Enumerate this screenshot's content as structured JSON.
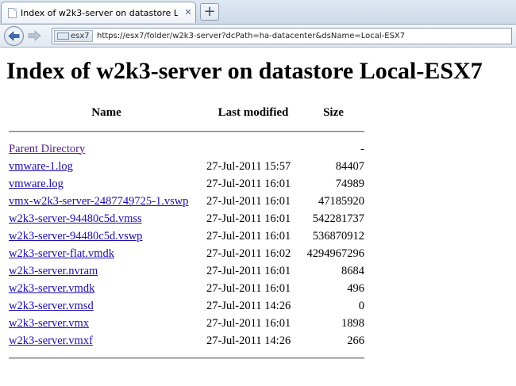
{
  "browser": {
    "tab_title": "Index of w2k3-server on datastore Local-ES...",
    "new_tab_symbol": "+",
    "site_chip": "esx7",
    "url": "https://esx7/folder/w2k3-server?dcPath=ha-datacenter&dsName=Local-ESX7"
  },
  "page": {
    "heading": "Index of w2k3-server on datastore Local-ESX7",
    "columns": {
      "name": "Name",
      "modified": "Last modified",
      "size": "Size"
    },
    "parent": {
      "name": "Parent Directory",
      "modified": "",
      "size": "-"
    },
    "files": [
      {
        "name": "vmware-1.log",
        "modified": "27-Jul-2011 15:57",
        "size": "84407"
      },
      {
        "name": "vmware.log",
        "modified": "27-Jul-2011 16:01",
        "size": "74989"
      },
      {
        "name": "vmx-w2k3-server-2487749725-1.vswp",
        "modified": "27-Jul-2011 16:01",
        "size": "47185920"
      },
      {
        "name": "w2k3-server-94480c5d.vmss",
        "modified": "27-Jul-2011 16:01",
        "size": "542281737"
      },
      {
        "name": "w2k3-server-94480c5d.vswp",
        "modified": "27-Jul-2011 16:01",
        "size": "536870912"
      },
      {
        "name": "w2k3-server-flat.vmdk",
        "modified": "27-Jul-2011 16:02",
        "size": "4294967296"
      },
      {
        "name": "w2k3-server.nvram",
        "modified": "27-Jul-2011 16:01",
        "size": "8684"
      },
      {
        "name": "w2k3-server.vmdk",
        "modified": "27-Jul-2011 16:01",
        "size": "496"
      },
      {
        "name": "w2k3-server.vmsd",
        "modified": "27-Jul-2011 14:26",
        "size": "0"
      },
      {
        "name": "w2k3-server.vmx",
        "modified": "27-Jul-2011 16:01",
        "size": "1898"
      },
      {
        "name": "w2k3-server.vmxf",
        "modified": "27-Jul-2011 14:26",
        "size": "266"
      }
    ]
  },
  "colors": {
    "link": "#1a0dab",
    "visited_link": "#551a8b"
  }
}
